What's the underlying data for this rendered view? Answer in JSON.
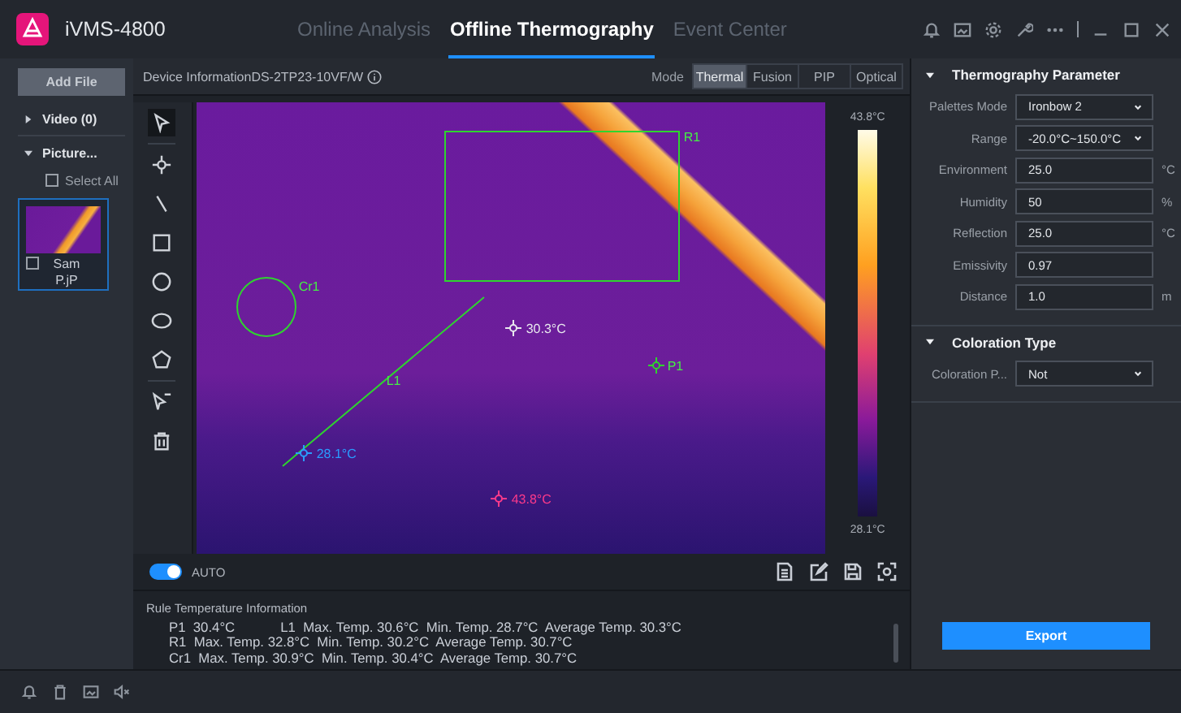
{
  "app": {
    "name": "iVMS-4800"
  },
  "nav_tabs": [
    {
      "label": "Online Analysis",
      "selected": false
    },
    {
      "label": "Offline Thermography",
      "selected": true
    },
    {
      "label": "Event Center",
      "selected": false
    }
  ],
  "sidebar": {
    "add_button": "Add File",
    "groups": [
      {
        "label": "Video (0)",
        "expanded": false
      },
      {
        "label": "Picture...",
        "expanded": true
      }
    ],
    "select_all": {
      "label": "Select All",
      "checked": false
    },
    "files": [
      {
        "name": "Sam P.jP",
        "checked": false,
        "selected": true
      }
    ]
  },
  "viewer": {
    "device_info": "Device InformationDS-2TP23-10VF/W",
    "mode_label": "Mode",
    "modes": [
      {
        "label": "Thermal",
        "selected": true
      },
      {
        "label": "Fusion",
        "selected": false
      },
      {
        "label": "PIP",
        "selected": false
      },
      {
        "label": "Optical",
        "selected": false
      }
    ],
    "tool_groups": [
      [
        {
          "kind": "pointer",
          "selected": true
        }
      ],
      [
        {
          "kind": "point",
          "selected": false
        },
        {
          "kind": "line",
          "selected": false
        },
        {
          "kind": "rectangle",
          "selected": false
        },
        {
          "kind": "circle",
          "selected": false
        },
        {
          "kind": "ellipse",
          "selected": false
        },
        {
          "kind": "polygon",
          "selected": false
        }
      ],
      [
        {
          "kind": "clear",
          "selected": false
        },
        {
          "kind": "delete",
          "selected": false
        }
      ]
    ],
    "rules": [
      {
        "kind": "rectangle",
        "label": "R1"
      },
      {
        "kind": "circle",
        "label": "Cr1"
      },
      {
        "kind": "line",
        "label": "L1"
      },
      {
        "kind": "point",
        "label": "P1"
      }
    ],
    "spot_readings": [
      {
        "kind": "center",
        "text": "30.3°C"
      },
      {
        "kind": "min",
        "text": "28.1°C"
      },
      {
        "kind": "max",
        "text": "43.8°C"
      }
    ],
    "scale": {
      "max": "43.8°C",
      "min": "28.1°C"
    },
    "auto": {
      "label": "AUTO",
      "on": true
    }
  },
  "rule_info": {
    "title": "Rule Temperature Information",
    "rows": [
      [
        "P1  30.4°C",
        "L1  Max. Temp. 30.6°C  Min. Temp. 28.7°C  Average Temp. 30.3°C"
      ],
      [
        "R1  Max. Temp. 32.8°C  Min. Temp. 30.2°C  Average Temp. 30.7°C"
      ],
      [
        "Cr1  Max. Temp. 30.9°C  Min. Temp. 30.4°C  Average Temp. 30.7°C"
      ]
    ]
  },
  "params": {
    "sections": [
      {
        "title": "Thermography Parameter",
        "expanded": true,
        "fields": [
          {
            "kind": "dropdown",
            "label": "Palettes Mode",
            "value": "Ironbow 2"
          },
          {
            "kind": "dropdown",
            "label": "Range",
            "value": "-20.0°C~150.0°C"
          },
          {
            "kind": "input",
            "label": "Environment",
            "value": "25.0",
            "unit": "°C"
          },
          {
            "kind": "input",
            "label": "Humidity",
            "value": "50",
            "unit": "%"
          },
          {
            "kind": "input",
            "label": "Reflection",
            "value": "25.0",
            "unit": "°C"
          },
          {
            "kind": "input",
            "label": "Emissivity",
            "value": "0.97"
          },
          {
            "kind": "input",
            "label": "Distance",
            "value": "1.0",
            "unit": "m"
          }
        ]
      },
      {
        "title": "Coloration Type",
        "expanded": true,
        "fields": [
          {
            "kind": "dropdown",
            "label": "Coloration P...",
            "value": "Not"
          }
        ]
      }
    ],
    "export_button": "Export"
  }
}
